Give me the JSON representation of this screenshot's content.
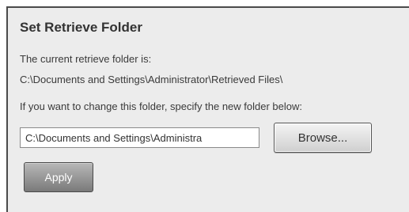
{
  "panel": {
    "title": "Set Retrieve Folder",
    "current_label": "The current retrieve folder is:",
    "current_path": "C:\\Documents and Settings\\Administrator\\Retrieved Files\\",
    "change_instruction": "If you want to change this folder, specify the new folder below:",
    "folder_input_value": "C:\\Documents and Settings\\Administra",
    "browse_label": "Browse...",
    "apply_label": "Apply"
  }
}
